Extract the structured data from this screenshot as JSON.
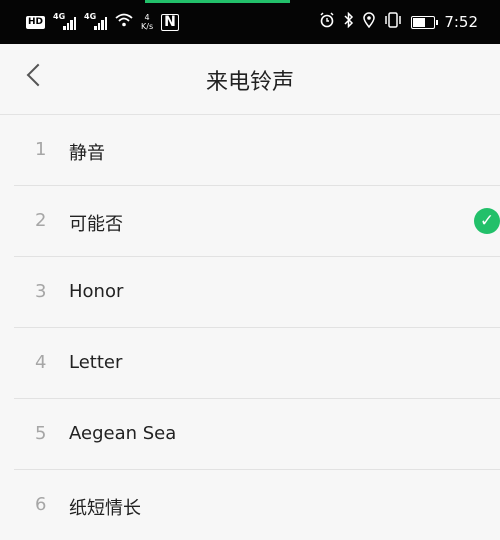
{
  "status_bar": {
    "hd": "HD",
    "signal1": "4G",
    "signal2": "4G",
    "speed_value": "4",
    "speed_unit": "K/s",
    "nfc": "N",
    "time": "7:52",
    "battery_level": 0.6
  },
  "header": {
    "title": "来电铃声"
  },
  "ringtones": [
    {
      "index": "1",
      "name": "静音"
    },
    {
      "index": "2",
      "name": "可能否",
      "selected": true
    },
    {
      "index": "3",
      "name": "Honor"
    },
    {
      "index": "4",
      "name": "Letter"
    },
    {
      "index": "5",
      "name": "Aegean Sea"
    },
    {
      "index": "6",
      "name": "纸短情长"
    }
  ],
  "colors": {
    "accent": "#22c06a",
    "status_bar": "#050505"
  }
}
